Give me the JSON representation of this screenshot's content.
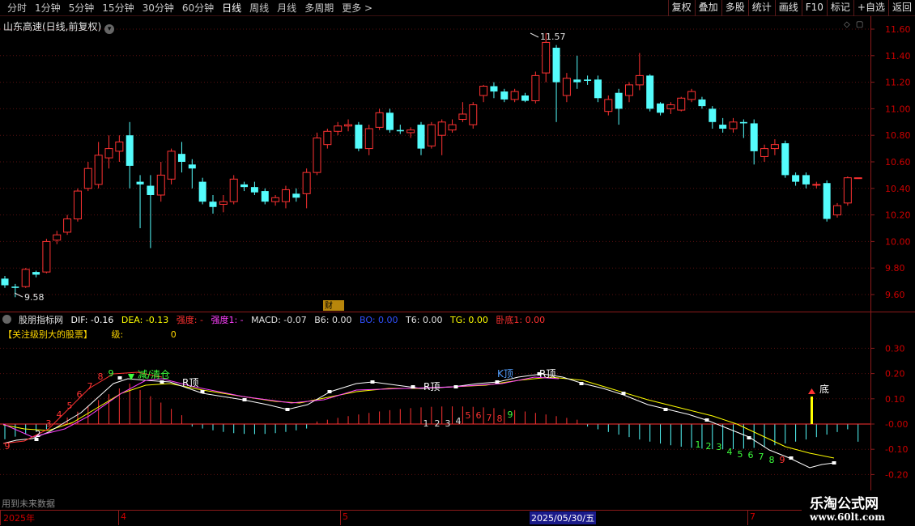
{
  "topbar": {
    "periods": [
      "分时",
      "1分钟",
      "5分钟",
      "15分钟",
      "30分钟",
      "60分钟",
      "日线",
      "周线",
      "月线",
      "多周期",
      "更多 >"
    ],
    "active_period": "日线",
    "tools": [
      "复权",
      "叠加",
      "多股",
      "统计",
      "画线",
      "F10",
      "标记",
      "+自选",
      "返回"
    ]
  },
  "main": {
    "title": "山东高速(日线,前复权)",
    "badge": "财",
    "high_label": "11.57",
    "low_label": "9.58",
    "price_ticks": [
      "11.60",
      "11.40",
      "11.20",
      "11.00",
      "10.80",
      "10.60",
      "10.40",
      "10.20",
      "10.00",
      "9.80",
      "9.60"
    ]
  },
  "indicator": {
    "name": "股朋指标网",
    "dif": "DIF: -0.16",
    "dea": "DEA: -0.13",
    "strength": "强度: -",
    "strength1": "强度1: -",
    "macd": "MACD: -0.07",
    "b6": "B6: 0.00",
    "bo": "BO: 0.00",
    "t6": "T6: 0.00",
    "tg": "TG: 0.00",
    "woDi": "卧底1: 0.00",
    "line2_label": "【关注级别大的股票】",
    "line2_key": "级:",
    "line2_val": "0",
    "ticks": [
      "0.30",
      "0.20",
      "0.10",
      "-0.00",
      "-0.10",
      "-0.20"
    ],
    "annotations": {
      "reduce": "减/清仓",
      "r_top1": "R顶",
      "r_top2": "R顶",
      "k_top": "K顶",
      "r_top3": "R顶",
      "bottom": "底"
    }
  },
  "dates": {
    "year": "2025年",
    "m4": "4",
    "m5": "5",
    "selected": "2025/05/30/五",
    "m7": "7"
  },
  "footer": {
    "future_note": "用到未来数据"
  },
  "watermark": {
    "line1": "乐淘公式网",
    "line2": "www.60lt.com"
  },
  "colors": {
    "up": "#ff3232",
    "down": "#54fcfc",
    "dif": "#ffffff",
    "dea": "#ffff00",
    "strength": "#ff00ff"
  },
  "chart_data": {
    "type": "candlestick",
    "ylim": [
      9.5,
      11.7
    ],
    "candles": [
      [
        9.72,
        9.67,
        9.74,
        9.65
      ],
      [
        9.66,
        9.65,
        9.68,
        9.58
      ],
      [
        9.66,
        9.79,
        9.8,
        9.65
      ],
      [
        9.77,
        9.75,
        9.78,
        9.73
      ],
      [
        9.77,
        10.0,
        10.02,
        9.76
      ],
      [
        10.01,
        10.05,
        10.08,
        9.98
      ],
      [
        10.07,
        10.17,
        10.2,
        10.05
      ],
      [
        10.17,
        10.38,
        10.4,
        10.15
      ],
      [
        10.4,
        10.55,
        10.6,
        10.38
      ],
      [
        10.43,
        10.65,
        10.75,
        10.4
      ],
      [
        10.63,
        10.7,
        10.8,
        10.55
      ],
      [
        10.68,
        10.75,
        10.8,
        10.6
      ],
      [
        10.8,
        10.57,
        10.9,
        10.4
      ],
      [
        10.45,
        10.43,
        10.5,
        10.1
      ],
      [
        10.42,
        10.35,
        10.5,
        9.95
      ],
      [
        10.35,
        10.5,
        10.6,
        10.3
      ],
      [
        10.47,
        10.68,
        10.7,
        10.43
      ],
      [
        10.66,
        10.6,
        10.75,
        10.52
      ],
      [
        10.58,
        10.55,
        10.62,
        10.4
      ],
      [
        10.45,
        10.3,
        10.48,
        10.28
      ],
      [
        10.3,
        10.26,
        10.35,
        10.21
      ],
      [
        10.28,
        10.3,
        10.35,
        10.22
      ],
      [
        10.3,
        10.47,
        10.5,
        10.28
      ],
      [
        10.43,
        10.41,
        10.45,
        10.38
      ],
      [
        10.41,
        10.37,
        10.45,
        10.35
      ],
      [
        10.38,
        10.3,
        10.4,
        10.28
      ],
      [
        10.3,
        10.33,
        10.35,
        10.27
      ],
      [
        10.3,
        10.39,
        10.42,
        10.25
      ],
      [
        10.36,
        10.33,
        10.4,
        10.3
      ],
      [
        10.36,
        10.52,
        10.55,
        10.25
      ],
      [
        10.52,
        10.78,
        10.82,
        10.5
      ],
      [
        10.73,
        10.83,
        10.85,
        10.7
      ],
      [
        10.83,
        10.87,
        10.9,
        10.8
      ],
      [
        10.87,
        10.88,
        10.92,
        10.83
      ],
      [
        10.88,
        10.7,
        10.9,
        10.68
      ],
      [
        10.7,
        10.85,
        10.88,
        10.65
      ],
      [
        10.86,
        10.97,
        11.0,
        10.84
      ],
      [
        10.97,
        10.84,
        11.0,
        10.82
      ],
      [
        10.84,
        10.83,
        10.88,
        10.81
      ],
      [
        10.82,
        10.84,
        10.86,
        10.78
      ],
      [
        10.88,
        10.7,
        10.9,
        10.65
      ],
      [
        10.72,
        10.88,
        10.9,
        10.7
      ],
      [
        10.8,
        10.9,
        10.92,
        10.65
      ],
      [
        10.84,
        10.88,
        10.92,
        10.82
      ],
      [
        10.92,
        10.96,
        11.05,
        10.9
      ],
      [
        10.88,
        11.03,
        11.05,
        10.85
      ],
      [
        11.1,
        11.17,
        11.18,
        11.05
      ],
      [
        11.17,
        11.13,
        11.2,
        11.08
      ],
      [
        11.13,
        11.07,
        11.15,
        11.05
      ],
      [
        11.07,
        11.13,
        11.15,
        11.05
      ],
      [
        11.1,
        11.06,
        11.12,
        11.05
      ],
      [
        11.06,
        11.25,
        11.28,
        11.04
      ],
      [
        11.27,
        11.5,
        11.57,
        11.2
      ],
      [
        11.46,
        11.2,
        11.48,
        10.9
      ],
      [
        11.1,
        11.23,
        11.27,
        11.05
      ],
      [
        11.22,
        11.2,
        11.4,
        11.15
      ],
      [
        11.22,
        11.21,
        11.25,
        11.18
      ],
      [
        11.22,
        11.08,
        11.25,
        11.05
      ],
      [
        10.98,
        11.07,
        11.1,
        10.95
      ],
      [
        11.12,
        11.0,
        11.15,
        10.88
      ],
      [
        11.1,
        11.18,
        11.2,
        11.05
      ],
      [
        11.18,
        11.25,
        11.42,
        11.14
      ],
      [
        11.25,
        11.0,
        11.26,
        10.98
      ],
      [
        11.04,
        10.97,
        11.05,
        10.95
      ],
      [
        11.0,
        11.03,
        11.05,
        10.96
      ],
      [
        10.99,
        11.08,
        11.09,
        10.98
      ],
      [
        11.07,
        11.13,
        11.15,
        11.05
      ],
      [
        11.07,
        11.02,
        11.09,
        11.0
      ],
      [
        11.0,
        10.9,
        11.02,
        10.85
      ],
      [
        10.88,
        10.85,
        10.93,
        10.82
      ],
      [
        10.85,
        10.9,
        10.93,
        10.82
      ],
      [
        10.9,
        10.89,
        10.92,
        10.78
      ],
      [
        10.89,
        10.68,
        10.92,
        10.58
      ],
      [
        10.64,
        10.7,
        10.73,
        10.6
      ],
      [
        10.7,
        10.73,
        10.77,
        10.65
      ],
      [
        10.74,
        10.5,
        10.76,
        10.48
      ],
      [
        10.5,
        10.45,
        10.52,
        10.42
      ],
      [
        10.5,
        10.43,
        10.52,
        10.4
      ],
      [
        10.43,
        10.43,
        10.45,
        10.4
      ],
      [
        10.44,
        10.17,
        10.46,
        10.15
      ],
      [
        10.2,
        10.27,
        10.29,
        10.18
      ],
      [
        10.29,
        10.48,
        10.49,
        10.27
      ],
      [
        10.48,
        10.48,
        10.48,
        10.48
      ]
    ]
  }
}
